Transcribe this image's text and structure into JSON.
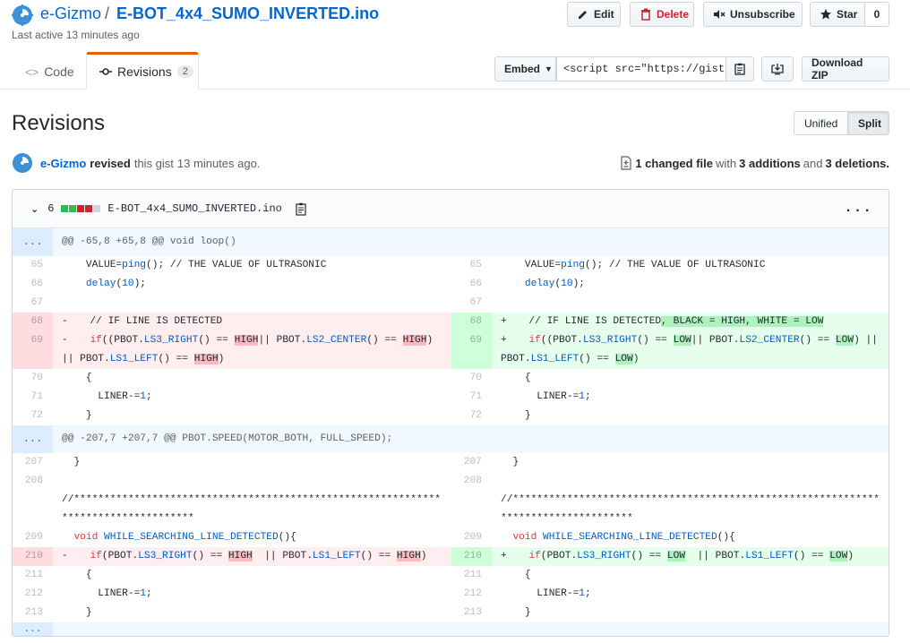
{
  "header": {
    "owner": "e-Gizmo",
    "separator": "/",
    "gist_name": "E-BOT_4x4_SUMO_INVERTED.ino",
    "last_active": "Last active 13 minutes ago",
    "edit_label": "Edit",
    "delete_label": "Delete",
    "unsubscribe_label": "Unsubscribe",
    "star_label": "Star",
    "star_count": "0"
  },
  "tabs": {
    "code_label": "Code",
    "revisions_label": "Revisions",
    "revisions_count": "2"
  },
  "embed": {
    "label": "Embed",
    "value": "<script src=\"https://gist.",
    "download_zip_label": "Download ZIP"
  },
  "revisions": {
    "title": "Revisions",
    "unified_label": "Unified",
    "split_label": "Split",
    "author": "e-Gizmo",
    "action": "revised",
    "text_mid": "this gist",
    "when": "13 minutes ago.",
    "summary_changed": "1 changed file",
    "summary_with": "with",
    "summary_additions": "3 additions",
    "summary_and": "and",
    "summary_deletions": "3 deletions."
  },
  "file": {
    "changes": "6",
    "name": "E-BOT_4x4_SUMO_INVERTED.ino",
    "menu": "···",
    "expand_label": "...",
    "hunk1": "@@ -65,8 +65,8 @@ void loop()",
    "hunk2": "@@ -207,7 +207,7 @@ PBOT.SPEED(MOTOR_BOTH, FULL_SPEED);"
  },
  "colors": {
    "link": "#0366d6",
    "deleted_bg": "#ffeef0",
    "added_bg": "#e6ffed",
    "hunk_bg": "#f1f8ff",
    "tab_accent": "#e36209"
  }
}
